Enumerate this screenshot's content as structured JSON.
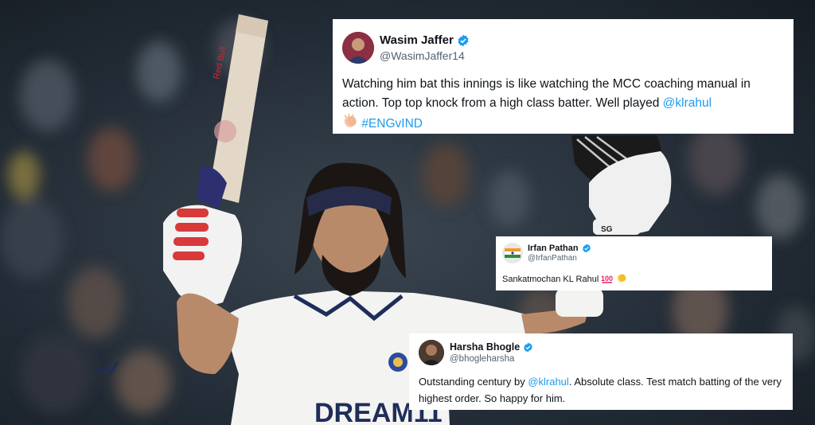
{
  "colors": {
    "link": "#1d9bf0",
    "verified": "#1d9bf0",
    "jersey": "#f3f3f1",
    "crowd": "#1d2630"
  },
  "photo": {
    "jersey_text": "DREAM11",
    "bat_text": "Red Bull",
    "icons": [
      "cricket-bat",
      "batting-glove",
      "helmet",
      "india-crest"
    ]
  },
  "tweets": [
    {
      "name": "Wasim Jaffer",
      "handle": "@WasimJaffer14",
      "text": "Watching him bat this innings is like watching the MCC coaching manual in action. Top top knock from a high class batter. Well played ",
      "mention": "@klrahul",
      "emoji": "clapping-hands-icon",
      "hashtag": "#ENGvIND"
    },
    {
      "name": "Irfan Pathan",
      "handle": "@IrfanPathan",
      "text": "Sankatmochan KL Rahul ",
      "emojis": [
        "hundred-points-icon",
        "clapping-hands-icon"
      ]
    },
    {
      "name": "Harsha Bhogle",
      "handle": "@bhogleharsha",
      "text_before": "Outstanding century by ",
      "mention": "@klrahul",
      "text_after": ". Absolute class. Test match batting of the very highest order. So happy for him."
    }
  ]
}
